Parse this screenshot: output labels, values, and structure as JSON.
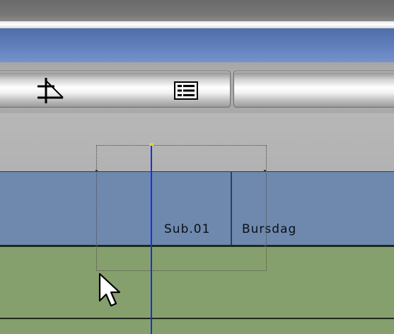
{
  "toolbar": {
    "snap_tool_icon": "snap-tool-icon",
    "list_view_icon": "list-view-icon"
  },
  "timeline": {
    "title_track": {
      "clips": [
        {
          "label": "Sub.01"
        },
        {
          "label": "Bursdag"
        }
      ]
    },
    "playhead_color": "#1a2de8"
  },
  "colors": {
    "title_track": "#6e89ad",
    "video_track": "#86a06d",
    "window_title_bar": "#5b7ab6"
  }
}
